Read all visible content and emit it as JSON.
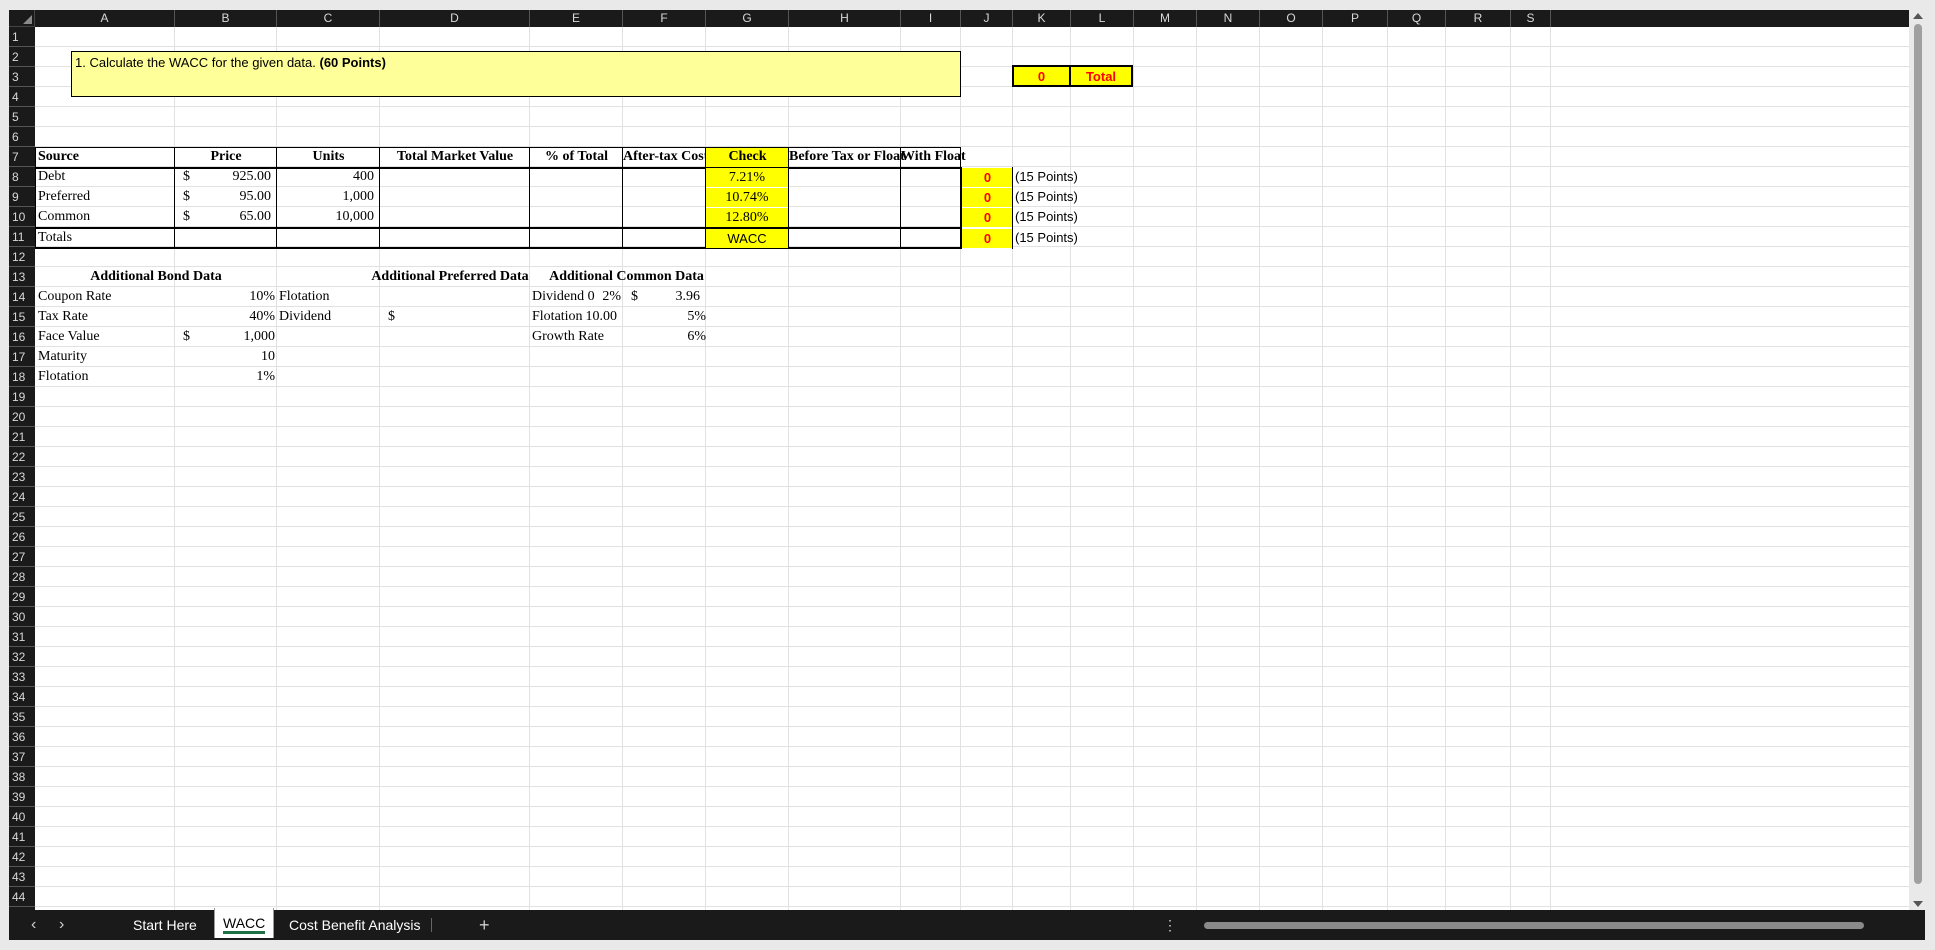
{
  "columns": [
    "A",
    "B",
    "C",
    "D",
    "E",
    "F",
    "G",
    "H",
    "I",
    "J",
    "K",
    "L",
    "M",
    "N",
    "O",
    "P",
    "Q",
    "R",
    "S"
  ],
  "rows": [
    "1",
    "2",
    "3",
    "4",
    "5",
    "6",
    "7",
    "8",
    "9",
    "10",
    "11",
    "12",
    "13",
    "14",
    "15",
    "16",
    "17",
    "18",
    "19",
    "20",
    "21",
    "22",
    "23",
    "24",
    "25",
    "26",
    "27",
    "28",
    "29",
    "30",
    "31",
    "32",
    "33",
    "34",
    "35",
    "36",
    "37",
    "38",
    "39",
    "40",
    "41",
    "42",
    "43",
    "44"
  ],
  "question": {
    "text": "1.  Calculate the WACC for the given data. ",
    "points": "(60 Points)"
  },
  "total": {
    "value": "0",
    "label": "Total"
  },
  "table": {
    "headers": [
      "Source",
      "Price",
      "Units",
      "Total Market Value",
      "% of Total",
      "After-tax Cost",
      "Check",
      "Before Tax or Float",
      "With Float"
    ],
    "rows": [
      {
        "source": "Debt",
        "dollar": "$",
        "price": "925.00",
        "units": "400",
        "check": "7.21%",
        "score": "0",
        "points": "(15 Points)"
      },
      {
        "source": "Preferred",
        "dollar": "$",
        "price": "95.00",
        "units": "1,000",
        "check": "10.74%",
        "score": "0",
        "points": "(15 Points)"
      },
      {
        "source": "Common",
        "dollar": "$",
        "price": "65.00",
        "units": "10,000",
        "check": "12.80%",
        "score": "0",
        "points": "(15 Points)"
      }
    ],
    "totals": {
      "source": "Totals",
      "check": "WACC",
      "score": "0",
      "points": "(15 Points)"
    }
  },
  "bond": {
    "title": "Additional Bond Data",
    "coupon": {
      "label": "Coupon Rate",
      "value": "10%"
    },
    "tax": {
      "label": "Tax Rate",
      "value": "40%"
    },
    "face": {
      "label": "Face Value",
      "dollar": "$",
      "value": "1,000"
    },
    "maturity": {
      "label": "Maturity",
      "value": "10"
    },
    "flotation": {
      "label": "Flotation",
      "value": "1%"
    }
  },
  "preferred": {
    "title": "Additional Preferred Data",
    "flotation": {
      "label": "Flotation",
      "value": "2%"
    },
    "dividend": {
      "label": "Dividend",
      "dollar": "$",
      "value": "10.00"
    }
  },
  "common": {
    "title": "Additional Common Data",
    "dividend": {
      "label": "Dividend 0",
      "dollar": "$",
      "value": "3.96"
    },
    "flotation": {
      "label": "Flotation",
      "value": "5%"
    },
    "growth": {
      "label": "Growth Rate",
      "value": "6%"
    }
  },
  "tabs": {
    "nav_prev": "‹",
    "nav_next": "›",
    "start": "Start Here",
    "wacc": "WACC",
    "cba": "Cost Benefit Analysis",
    "add": "+",
    "menu": "⋮"
  },
  "colors": {
    "yellow": "#ffff00",
    "light_yellow": "#ffff99",
    "red": "#ff0000",
    "tab_underline": "#1e7145"
  }
}
